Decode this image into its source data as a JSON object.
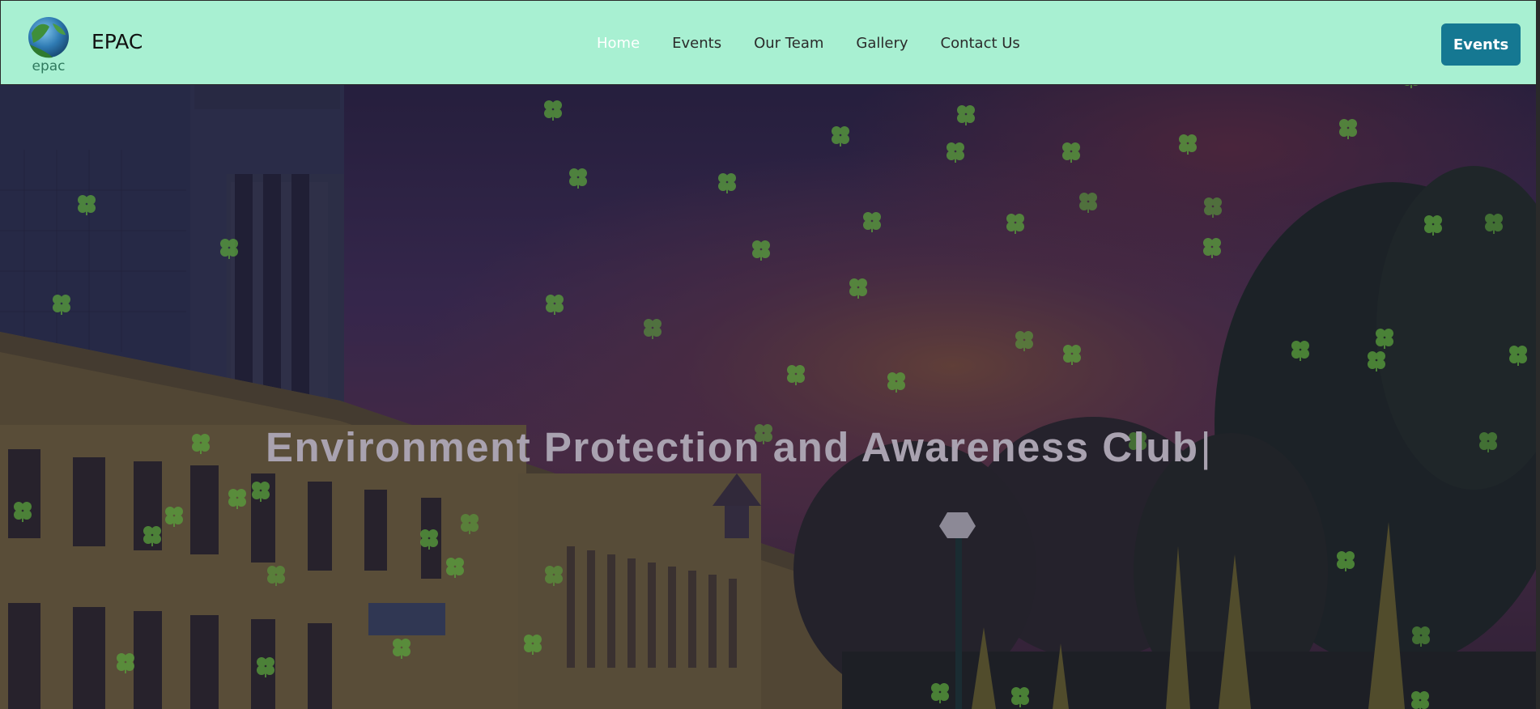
{
  "brand": {
    "name": "EPAC",
    "logo_text": "epac"
  },
  "nav": {
    "links": [
      {
        "label": "Home",
        "active": true
      },
      {
        "label": "Events",
        "active": false
      },
      {
        "label": "Our Team",
        "active": false
      },
      {
        "label": "Gallery",
        "active": false
      },
      {
        "label": "Contact Us",
        "active": false
      }
    ],
    "cta_label": "Events"
  },
  "hero": {
    "title": "Environment Protection and Awareness Club",
    "cursor": "|"
  },
  "colors": {
    "navbar_bg": "#a8f0d2",
    "cta_bg": "#157892",
    "active_link": "#ffffff",
    "clover": "#5aa23c"
  },
  "icons": [
    "globe-logo-icon",
    "clover-icon"
  ]
}
